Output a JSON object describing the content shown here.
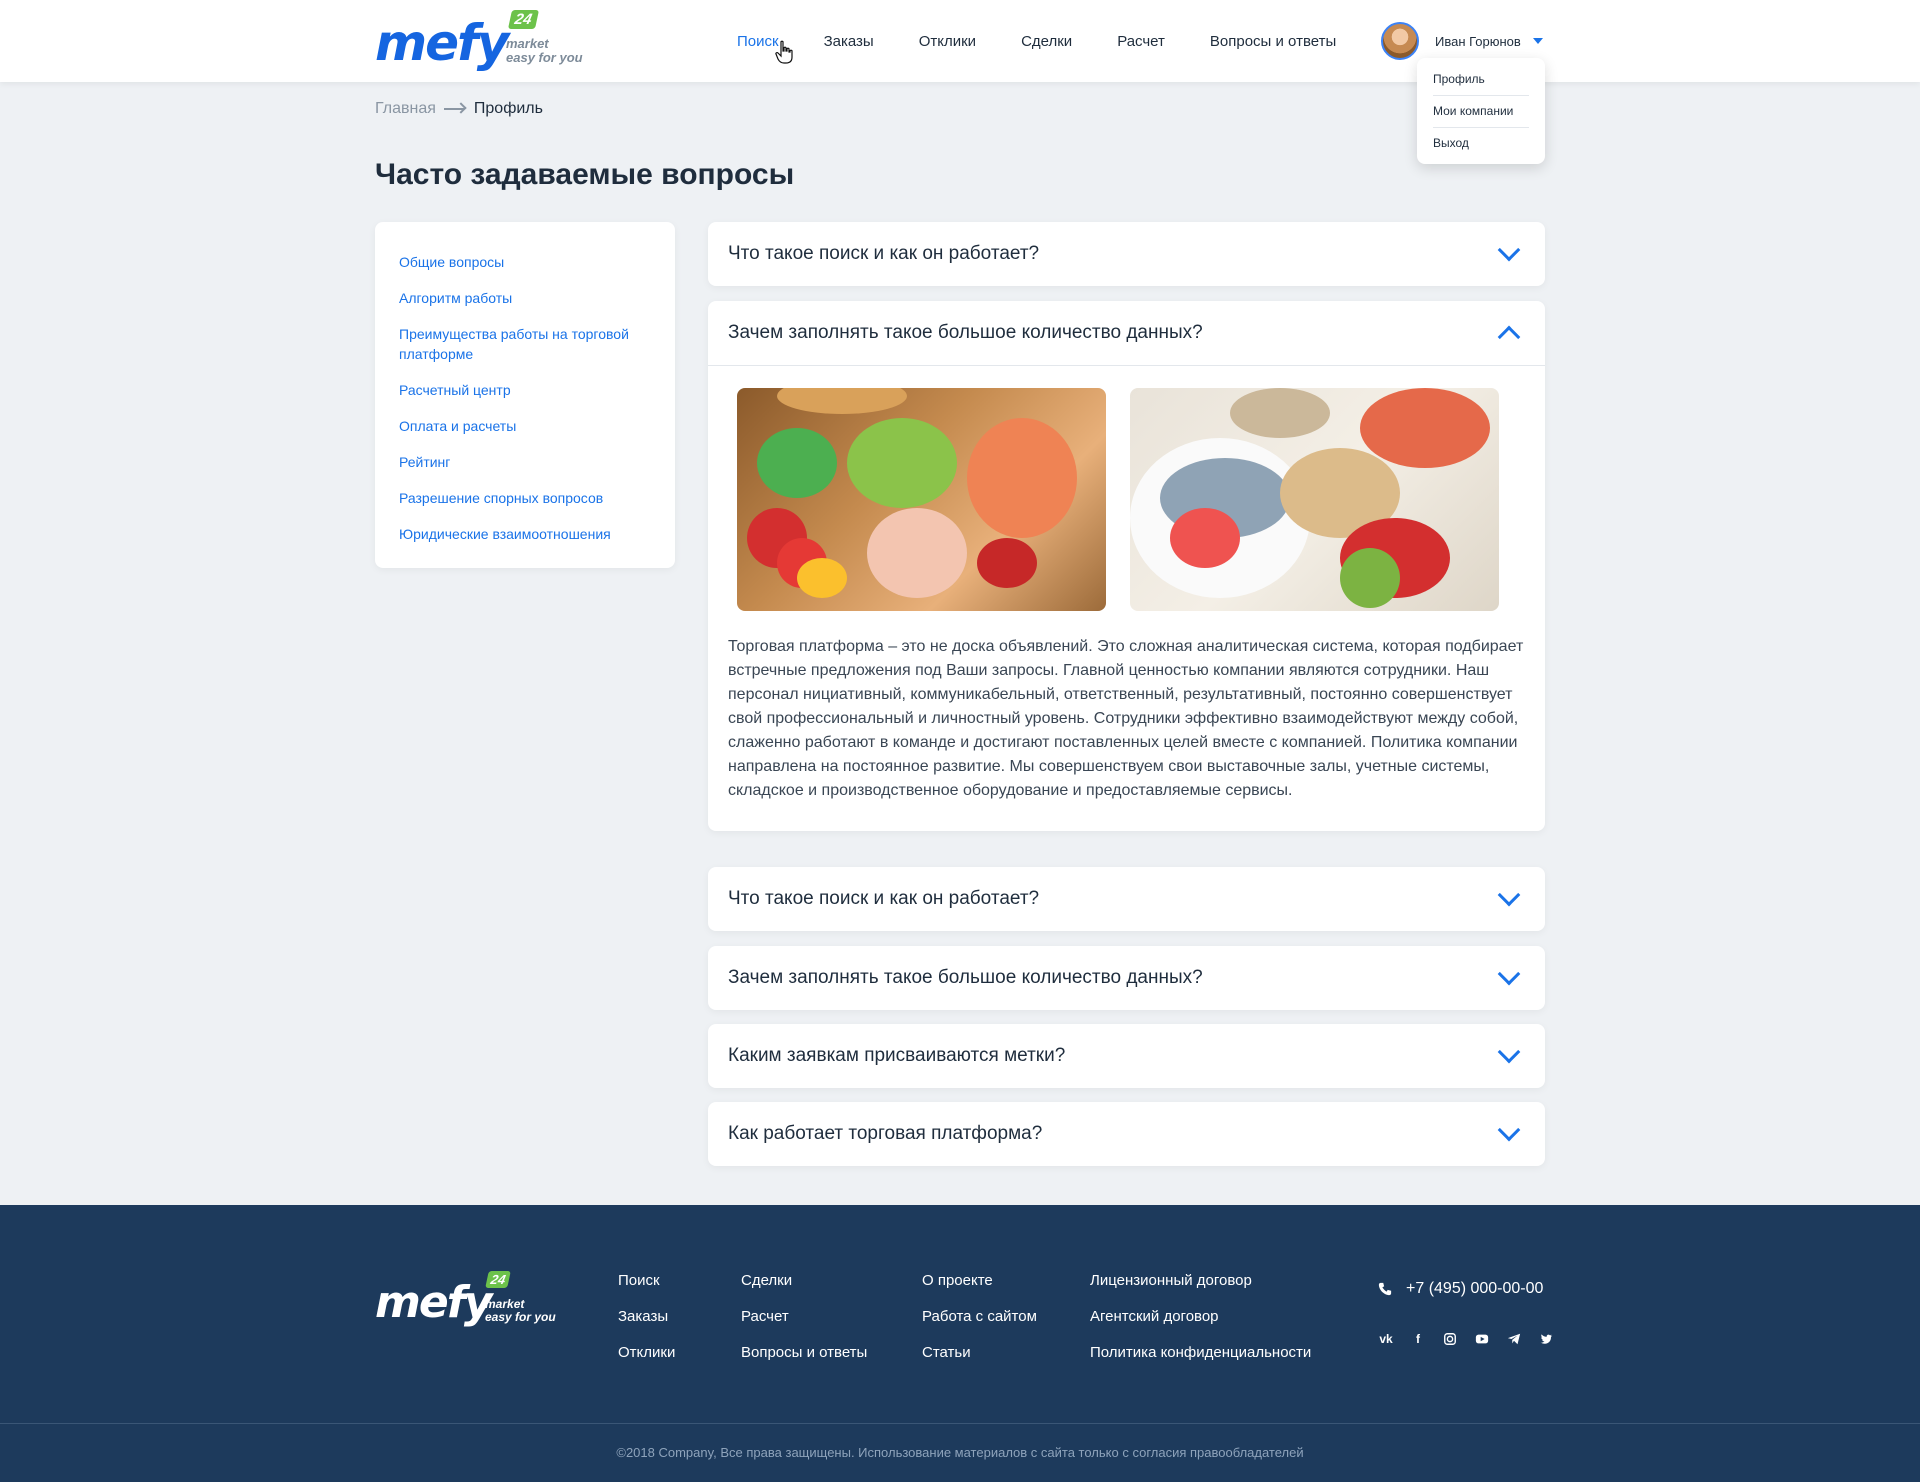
{
  "header": {
    "logo": {
      "word": "mefy",
      "badge": "24",
      "tagline1": "market",
      "tagline2": "easy for you"
    },
    "nav": [
      "Поиск",
      "Заказы",
      "Отклики",
      "Сделки",
      "Расчет",
      "Вопросы и ответы"
    ],
    "user": {
      "name": "Иван Горюнов",
      "menu": [
        "Профиль",
        "Мои компании",
        "Выход"
      ]
    }
  },
  "breadcrumb": {
    "home": "Главная",
    "current": "Профиль"
  },
  "page_title": "Часто задаваемые вопросы",
  "sidebar": {
    "items": [
      "Общие вопросы",
      "Алгоритм работы",
      "Преимущества работы на торговой платформе",
      "Расчетный центр",
      "Оплата и расчеты",
      "Рейтинг",
      "Разрешение спорных вопросов",
      "Юридические взаимоотношения"
    ]
  },
  "faq": [
    {
      "question": "Что такое поиск и как он работает?",
      "expanded": false
    },
    {
      "question": "Зачем заполнять такое большое количество данных?",
      "expanded": true,
      "answer": "Торговая платформа – это не доска объявлений. Это сложная аналитическая система, которая подбирает встречные предложения под Ваши запросы. Главной ценностью компании являются сотрудники. Наш персонал нициативный, коммуникабельный, ответственный, результативный, постоянно совершенствует свой профессиональный и личностный уровень. Сотрудники эффективно взаимодействуют между собой, слаженно работают в команде и достигают поставленных целей вместе с компанией. Политика компании направлена на постоянное развитие. Мы совершенствуем свои выставочные залы, учетные системы, складское и производственное оборудование и предоставляемые сервисы."
    },
    {
      "question": "Что такое поиск и как он работает?",
      "expanded": false
    },
    {
      "question": "Зачем заполнять такое большое количество данных?",
      "expanded": false
    },
    {
      "question": "Каким заявкам присваиваются метки?",
      "expanded": false
    },
    {
      "question": "Как работает торговая платформа?",
      "expanded": false
    }
  ],
  "footer": {
    "col1": [
      "Поиск",
      "Заказы",
      "Отклики"
    ],
    "col2": [
      "Сделки",
      "Расчет",
      "Вопросы и ответы"
    ],
    "col3": [
      "О проекте",
      "Работа с сайтом",
      "Статьи"
    ],
    "col4": [
      "Лицензионный договор",
      "Агентский договор",
      "Политика конфиденциальности"
    ],
    "phone": "+7 (495) 000-00-00",
    "socials": [
      "vk-icon",
      "facebook-icon",
      "instagram-icon",
      "youtube-icon",
      "telegram-icon",
      "twitter-icon"
    ],
    "copyright": "©2018 Company, Все права защищены.  Использование материалов с сайта только с согласия правообладателей"
  },
  "colors": {
    "accent": "#1a73e8",
    "brand_green": "#6cc24a",
    "footer_bg": "#1d3a5c",
    "page_bg": "#eef1f4"
  }
}
